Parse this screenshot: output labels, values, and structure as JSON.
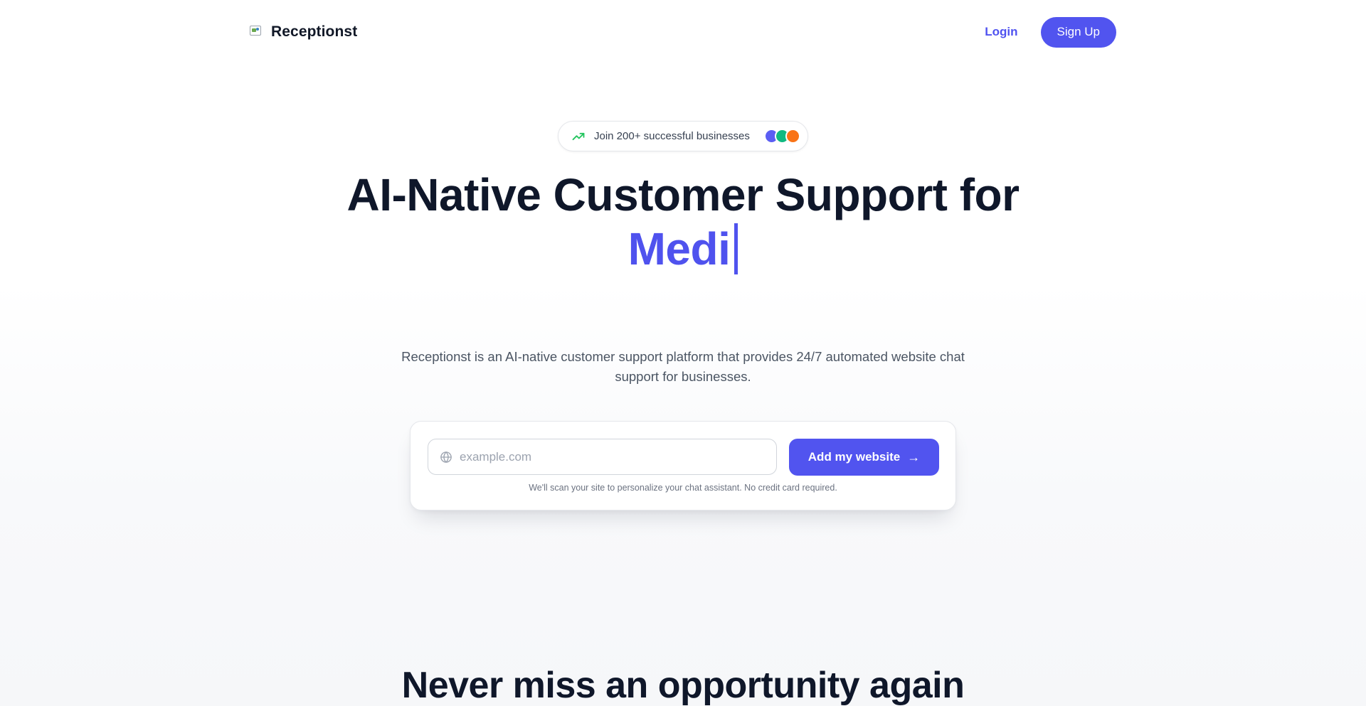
{
  "header": {
    "brand_name": "Receptionst",
    "login_label": "Login",
    "signup_label": "Sign Up"
  },
  "badge": {
    "text": "Join 200+ successful businesses",
    "avatar_colors": [
      "#5b5ef3",
      "#10b981",
      "#f97316"
    ]
  },
  "hero": {
    "title": "AI-Native Customer Support for",
    "accent_text": "Medi",
    "description": "Receptionst is an AI-native customer support platform that provides 24/7 automated website chat support for businesses."
  },
  "signup_card": {
    "input_placeholder": "example.com",
    "input_value": "",
    "button_label": "Add my website",
    "button_arrow": "→",
    "note": "We'll scan your site to personalize your chat assistant. No credit card required."
  },
  "section": {
    "title": "Never miss an opportunity again"
  },
  "colors": {
    "accent": "#5154ef",
    "heading": "#0f172a",
    "trend_green": "#22c55e"
  }
}
